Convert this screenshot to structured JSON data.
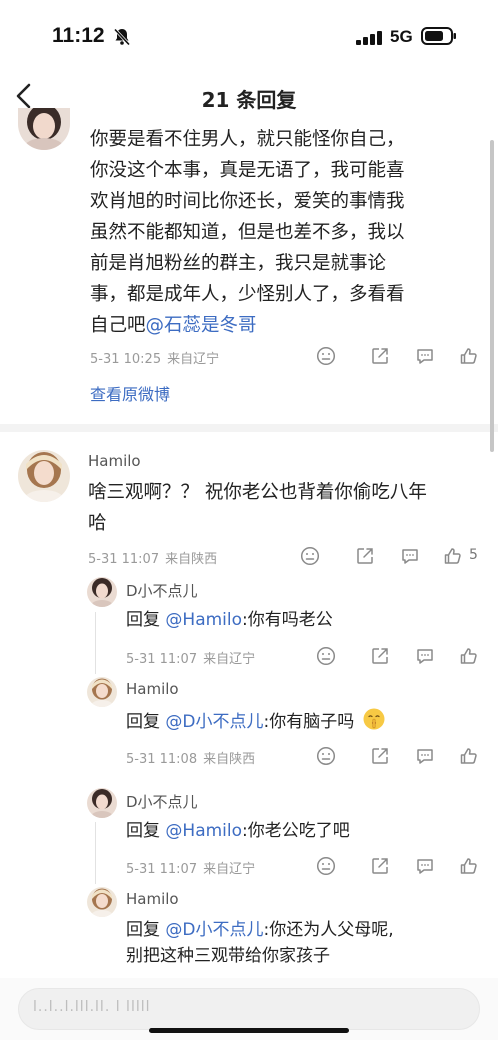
{
  "status_bar": {
    "time": "11:12",
    "network": "5G",
    "mute": "bell-slash-icon",
    "signal": "signal-bars-icon",
    "battery": "battery-icon"
  },
  "nav": {
    "title": "21 条回复",
    "back_icon": "chevron-left-icon"
  },
  "main_comment": {
    "lines": [
      "你要是看不住男人，就只能怪你自己，",
      "你没这个本事，真是无语了，我可能喜",
      "欢肖旭的时间比你还长，爱笑的事情我",
      "虽然不能都知道，但是也差不多，我以",
      "前是肖旭粉丝的群主，我只是就事论",
      "事，都是成年人，少怪别人了，多看看"
    ],
    "last_line": "自己吧",
    "mention": "@石蕊是冬哥",
    "date": "5-31 10:25",
    "location": "来自辽宁",
    "view_original": "查看原微博"
  },
  "reply_main": {
    "name": "Hamilo",
    "lines": [
      "啥三观啊？？ 祝你老公也背着你偷吃八年",
      "哈"
    ],
    "date": "5-31 11:07",
    "location": "来自陕西",
    "like_count": "5"
  },
  "sub_replies": [
    {
      "name": "D小不点儿",
      "prefix": "回复 ",
      "mention": "@Hamilo",
      "text": ":你有吗老公",
      "date": "5-31 11:07",
      "location": "来自辽宁"
    },
    {
      "name": "Hamilo",
      "prefix": "回复 ",
      "mention": "@D小不点儿",
      "text": ":你有脑子吗",
      "date": "5-31 11:08",
      "location": "来自陕西"
    },
    {
      "name": "D小不点儿",
      "prefix": "回复 ",
      "mention": "@Hamilo",
      "text": ":你老公吃了吧",
      "date": "5-31 11:07",
      "location": "来自辽宁"
    },
    {
      "name": "Hamilo",
      "prefix": "回复 ",
      "mention": "@D小不点儿",
      "text": ":你还为人父母呢,",
      "line2": "别把这种三观带给你家孩子"
    }
  ],
  "bottom_bar": {
    "placeholder": "l..l..l.lll.ll. l lllll"
  },
  "icons": [
    "emoji-icon",
    "share-icon",
    "comment-icon",
    "like-icon"
  ],
  "colors": {
    "accent": "#3d6cc2",
    "meta_gray": "#9a9a9a",
    "text": "#222222"
  }
}
